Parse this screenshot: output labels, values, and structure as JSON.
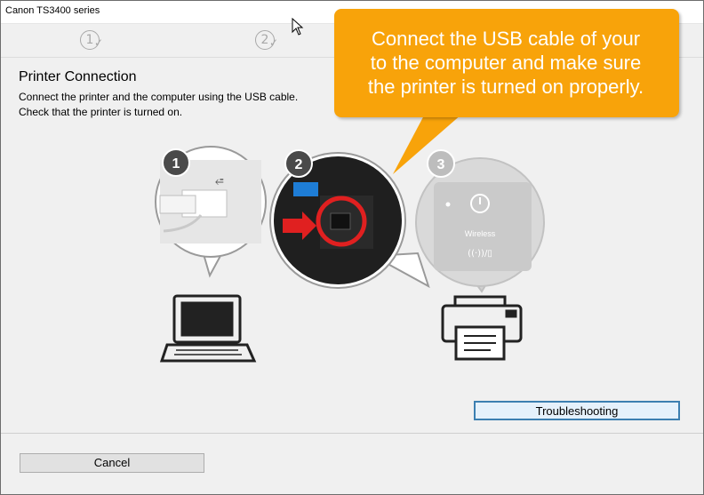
{
  "window": {
    "title": "Canon TS3400 series"
  },
  "steps": [
    {
      "number": "1"
    },
    {
      "number": "2"
    }
  ],
  "page": {
    "heading": "Printer Connection",
    "description_line1": "Connect the printer and the computer using the USB cable.",
    "description_line2": "Check that the printer is turned on."
  },
  "callout": {
    "line1": "Connect the USB cable of your",
    "line2": "to the computer and make sure",
    "line3": "the printer is turned on properly."
  },
  "illustration": {
    "badges": [
      "1",
      "2",
      "3"
    ],
    "panel_label": "Wireless",
    "accent_color": "#f8a30a",
    "highlight_color": "#e02020"
  },
  "buttons": {
    "troubleshooting": "Troubleshooting",
    "cancel": "Cancel"
  }
}
